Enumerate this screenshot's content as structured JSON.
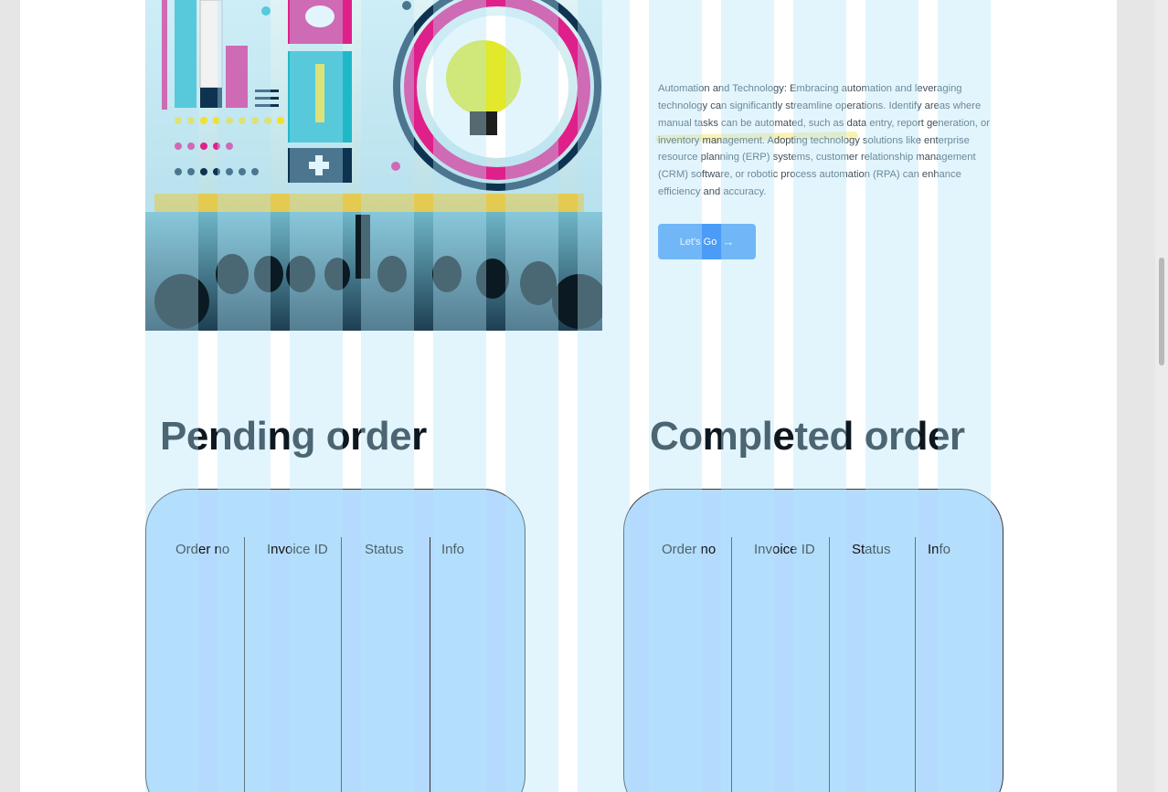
{
  "hero": {
    "image_label": "Illustration of a business meeting with infographic elements and a lightbulb"
  },
  "copy": {
    "paragraph": "Automation and Technology: Embracing automation and leveraging technology can significantly streamline operations. Identify areas where manual tasks can be automated, such as data entry, report generation, or inventory management. Adopting technology solutions like enterprise resource planning (ERP) systems, customer relationship management (CRM) software, or robotic process automation (RPA) can enhance efficiency and accuracy.",
    "cta_label": "Let's Go",
    "cta_icon": "→"
  },
  "pending": {
    "title": "Pending order",
    "columns": [
      "Order no",
      "Invoice ID",
      "Status",
      "Info"
    ]
  },
  "completed": {
    "title": "Completed order",
    "columns": [
      "Order no",
      "Invoice ID",
      "Status",
      "Info"
    ]
  },
  "colors": {
    "page_bg": "#ffffff",
    "outer_bg": "#e6e6e6",
    "cta_bg": "#4a9cf6",
    "card_bg": "#b4dafe",
    "title": "#0d1720"
  }
}
